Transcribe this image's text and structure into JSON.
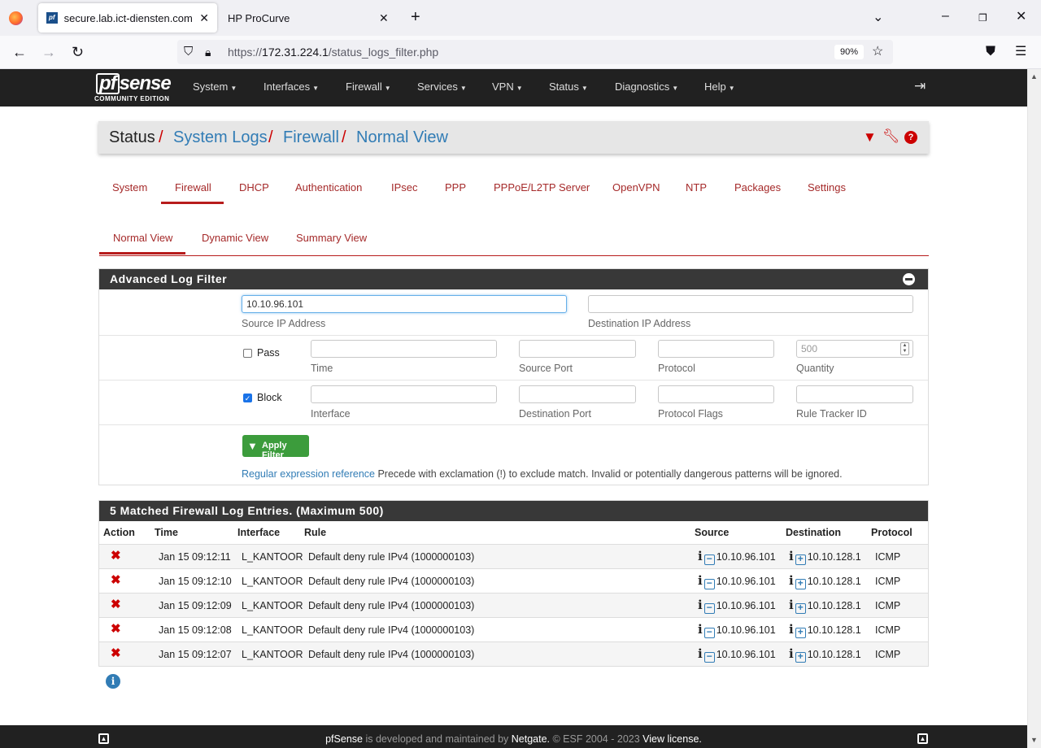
{
  "browser": {
    "tabs": [
      {
        "label": "secure.lab.ict-diensten.com - St",
        "active": true
      },
      {
        "label": "HP ProCurve",
        "active": false
      }
    ],
    "url_prefix": "https://",
    "url_host": "172.31.224.1",
    "url_path": "/status_logs_filter.php",
    "zoom": "90%"
  },
  "nav": {
    "logo_main": "sense",
    "logo_pf": "pf",
    "logo_sub": "COMMUNITY EDITION",
    "items": [
      "System",
      "Interfaces",
      "Firewall",
      "Services",
      "VPN",
      "Status",
      "Diagnostics",
      "Help"
    ]
  },
  "breadcrumb": {
    "root": "Status",
    "sep": "/",
    "path": [
      "System Logs",
      "Firewall",
      "Normal View"
    ]
  },
  "log_tabs": [
    "System",
    "Firewall",
    "DHCP",
    "Authentication",
    "IPsec",
    "PPP",
    "PPPoE/L2TP Server",
    "OpenVPN",
    "NTP",
    "Packages",
    "Settings"
  ],
  "view_tabs": [
    "Normal View",
    "Dynamic View",
    "Summary View"
  ],
  "filter": {
    "title": "Advanced Log Filter",
    "source_ip_value": "10.10.96.101",
    "source_ip_label": "Source IP Address",
    "dest_ip_value": "",
    "dest_ip_label": "Destination IP Address",
    "pass_label": "Pass",
    "pass_checked": false,
    "block_label": "Block",
    "block_checked": true,
    "time_label": "Time",
    "source_port_label": "Source Port",
    "protocol_label": "Protocol",
    "quantity_label": "Quantity",
    "quantity_placeholder": "500",
    "interface_label": "Interface",
    "dest_port_label": "Destination Port",
    "protocol_flags_label": "Protocol Flags",
    "rule_tracker_label": "Rule Tracker ID",
    "apply_label": "Apply Filter",
    "regex_link": "Regular expression reference",
    "regex_help": "Precede with exclamation (!) to exclude match. Invalid or potentially dangerous patterns will be ignored."
  },
  "log": {
    "title": "5 Matched Firewall Log Entries. (Maximum 500)",
    "headers": {
      "action": "Action",
      "time": "Time",
      "interface": "Interface",
      "rule": "Rule",
      "source": "Source",
      "destination": "Destination",
      "protocol": "Protocol"
    },
    "rows": [
      {
        "time": "Jan 15 09:12:11",
        "interface": "L_KANTOOR",
        "rule": "Default deny rule IPv4 (1000000103)",
        "source": "10.10.96.101",
        "destination": "10.10.128.1",
        "protocol": "ICMP"
      },
      {
        "time": "Jan 15 09:12:10",
        "interface": "L_KANTOOR",
        "rule": "Default deny rule IPv4 (1000000103)",
        "source": "10.10.96.101",
        "destination": "10.10.128.1",
        "protocol": "ICMP"
      },
      {
        "time": "Jan 15 09:12:09",
        "interface": "L_KANTOOR",
        "rule": "Default deny rule IPv4 (1000000103)",
        "source": "10.10.96.101",
        "destination": "10.10.128.1",
        "protocol": "ICMP"
      },
      {
        "time": "Jan 15 09:12:08",
        "interface": "L_KANTOOR",
        "rule": "Default deny rule IPv4 (1000000103)",
        "source": "10.10.96.101",
        "destination": "10.10.128.1",
        "protocol": "ICMP"
      },
      {
        "time": "Jan 15 09:12:07",
        "interface": "L_KANTOOR",
        "rule": "Default deny rule IPv4 (1000000103)",
        "source": "10.10.96.101",
        "destination": "10.10.128.1",
        "protocol": "ICMP"
      }
    ]
  },
  "footer": {
    "brand": "pfSense",
    "text1": " is developed and maintained by ",
    "company": "Netgate.",
    "text2": " © ESF 2004 - 2023 ",
    "license": "View license."
  },
  "colors": {
    "accent": "#b71c1c",
    "link": "#317cb5",
    "navbar": "#212121",
    "apply": "#3c9c3c"
  }
}
